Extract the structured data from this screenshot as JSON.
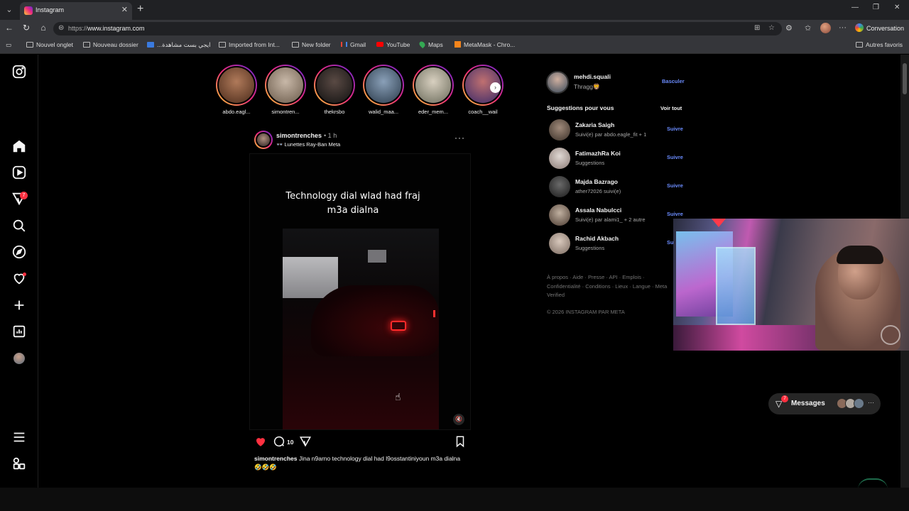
{
  "browser": {
    "tab_title": "Instagram",
    "url_scheme": "https://",
    "url_host": "www.instagram.com",
    "conversation_label": "Conversation",
    "bookmarks": [
      {
        "label": "Nouvel onglet",
        "icon": "tab-icon"
      },
      {
        "label": "Nouveau dossier",
        "icon": "folder-icon"
      },
      {
        "label": "...ايجي بست مشاهدة",
        "icon": "site-icon"
      },
      {
        "label": "Imported from Int...",
        "icon": "folder-icon"
      },
      {
        "label": "New folder",
        "icon": "folder-icon"
      },
      {
        "label": "Gmail",
        "icon": "gmail-icon"
      },
      {
        "label": "YouTube",
        "icon": "youtube-icon"
      },
      {
        "label": "Maps",
        "icon": "maps-icon"
      },
      {
        "label": "MetaMask - Chro...",
        "icon": "metamask-icon"
      }
    ],
    "other_bookmarks": "Autres favoris"
  },
  "nav": {
    "notification_badge": "7"
  },
  "stories": [
    {
      "name": "abdo.eagl...",
      "color": "#6a3a2a"
    },
    {
      "name": "simontren...",
      "color": "#8a7a6a"
    },
    {
      "name": "thekrsbo",
      "color": "#2a2a2a"
    },
    {
      "name": "walid_maa...",
      "color": "#3a4a5a"
    },
    {
      "name": "eder_mem...",
      "color": "#7a7a6a"
    },
    {
      "name": "coach__wail",
      "color": "#6a3a5a"
    }
  ],
  "post": {
    "username": "simontrenches",
    "time": "• 1 h",
    "subtitle": "Lunettes Ray-Ban Meta",
    "media_caption_line1": "Technology dial wlad had fraj",
    "media_caption_line2": "m3a dialna",
    "comment_count": "10",
    "caption_user": "simontrenches",
    "caption_text": "Jina n9arno technology dial had l9osstantiniyoun m3a dialna 🤣🤣🤣"
  },
  "profile": {
    "username": "mehdi.squali",
    "name": "Thragg🦁",
    "switch_label": "Basculer"
  },
  "suggestions": {
    "title": "Suggestions pour vous",
    "see_all": "Voir tout",
    "follow_label": "Suivre",
    "items": [
      {
        "name": "Zakaria Saigh",
        "sub": "Suivi(e) par abdo.eagle_fit + 1",
        "color": "#7a6a5a"
      },
      {
        "name": "FatimazhRa Koi",
        "sub": "Suggestions",
        "color": "#b0a8a4"
      },
      {
        "name": "Majda Bazrago",
        "sub": "ather72026 suivi(e)",
        "color": "#4a4a4a"
      },
      {
        "name": "Assala Nabulcci",
        "sub": "Suivi(e) par alami1_ + 2 autre",
        "color": "#8a7a6a"
      },
      {
        "name": "Rachid Akbach",
        "sub": "Suggestions",
        "color": "#9a8a80"
      }
    ]
  },
  "footer": {
    "links": "À propos · Aide · Presse · API · Emplois · Confidentialité · Conditions · Lieux · Langue · Meta Verified",
    "copyright": "© 2026 INSTAGRAM PAR META"
  },
  "messages": {
    "label": "Messages",
    "badge": "7"
  },
  "colors": {
    "accent_link": "#6b8cff",
    "like_red": "#ff3040",
    "background": "#000000"
  }
}
